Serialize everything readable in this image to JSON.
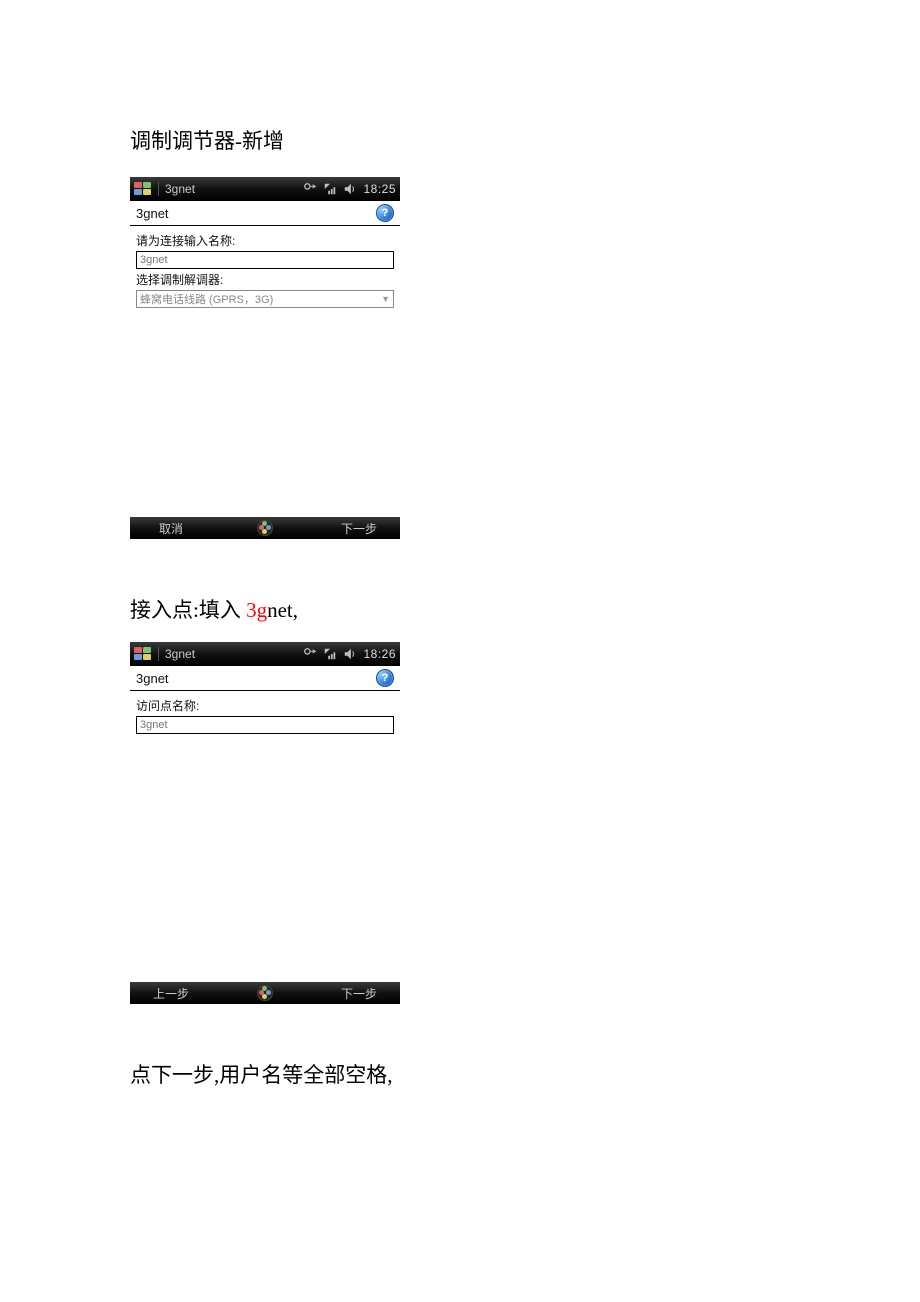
{
  "heading1": "调制调节器-新增",
  "screen1": {
    "topbar_title": "3gnet",
    "clock": "18:25",
    "app_title": "3gnet",
    "help_glyph": "?",
    "label_name": "请为连接输入名称:",
    "input_name_value": "3gnet",
    "label_modem": "选择调制解调器:",
    "combo_modem_value": "蜂窝电话线路 (GPRS，3G)",
    "soft_left": "取消",
    "soft_right": "下一步"
  },
  "caption2_prefix": "接入点:填入 ",
  "caption2_red": "3g",
  "caption2_suffix": "net,",
  "screen2": {
    "topbar_title": "3gnet",
    "clock": "18:26",
    "app_title": "3gnet",
    "help_glyph": "?",
    "label_apn": "访问点名称:",
    "input_apn_value": "3gnet",
    "soft_left": "上一步",
    "soft_right": "下一步"
  },
  "caption3": "点下一步,用户名等全部空格,"
}
